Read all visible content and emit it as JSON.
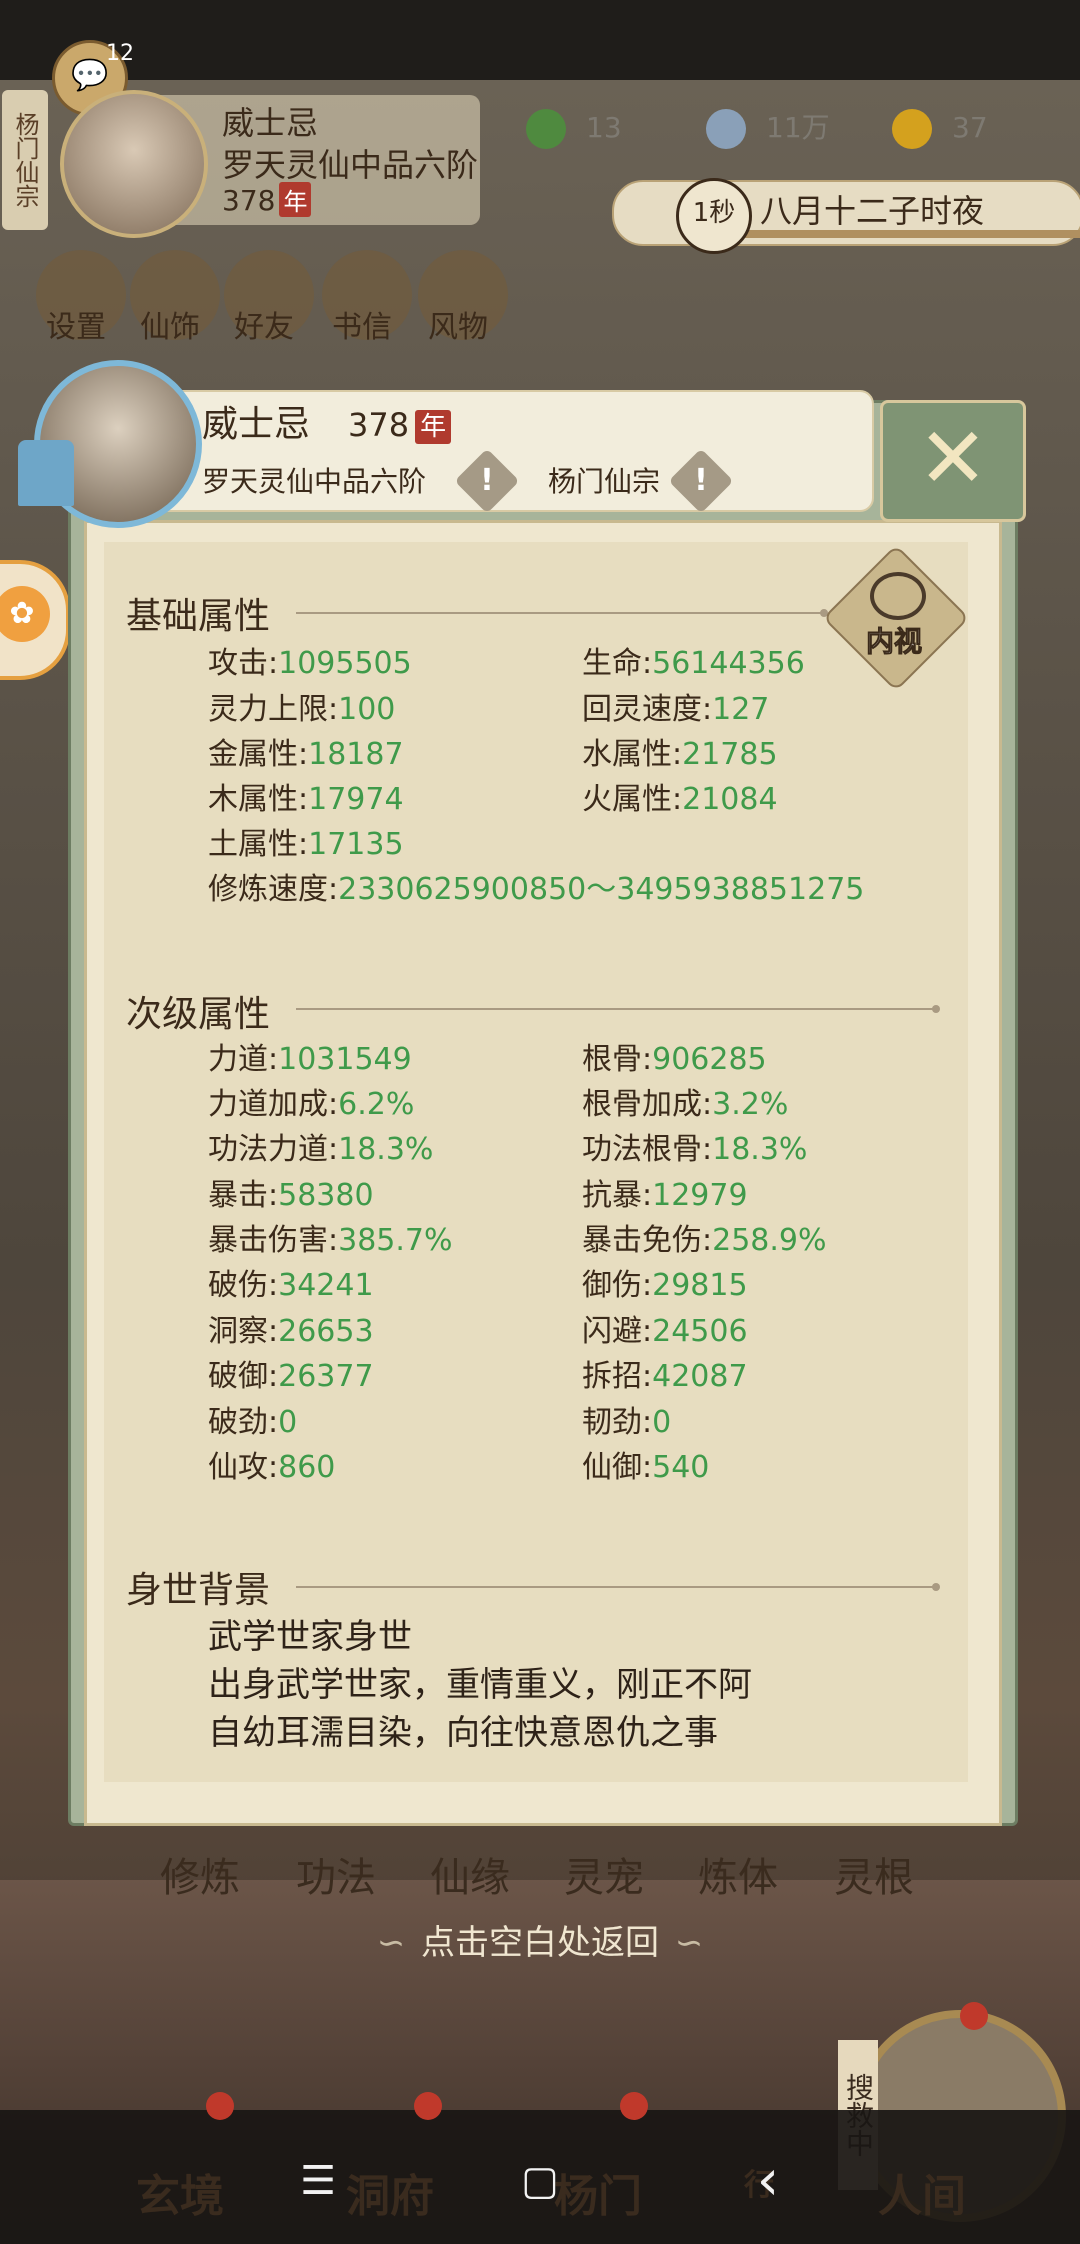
{
  "hud": {
    "side_tag": "杨门仙宗",
    "chat_count": "12",
    "name": "威士忌",
    "rank": "罗天灵仙中品六阶",
    "age": "378",
    "age_tag": "年",
    "resources": [
      {
        "icon": "leaf-icon",
        "value": "13"
      },
      {
        "icon": "coin-icon",
        "value": "11万"
      },
      {
        "icon": "trophy-icon",
        "value": "37"
      }
    ],
    "time_badge": "1秒",
    "time_text": "八月十二子时夜"
  },
  "menu": [
    {
      "label": "设置",
      "icon": "settings-icon"
    },
    {
      "label": "仙饰",
      "icon": "ornament-icon"
    },
    {
      "label": "好友",
      "icon": "friends-icon"
    },
    {
      "label": "书信",
      "icon": "letter-icon"
    },
    {
      "label": "风物",
      "icon": "scenery-icon"
    }
  ],
  "dialog": {
    "name": "威士忌",
    "age": "378",
    "age_tag": "年",
    "rank": "罗天灵仙中品六阶",
    "sect": "杨门仙宗",
    "close_label": "✕",
    "eye_label": "内视",
    "basic": {
      "title": "基础属性",
      "left": [
        {
          "k": "攻击",
          "v": "1095505"
        },
        {
          "k": "灵力上限",
          "v": "100"
        },
        {
          "k": "金属性",
          "v": "18187"
        },
        {
          "k": "木属性",
          "v": "17974"
        },
        {
          "k": "土属性",
          "v": "17135"
        },
        {
          "k": "修炼速度",
          "v": "2330625900850～3495938851275"
        }
      ],
      "right": [
        {
          "k": "生命",
          "v": "56144356"
        },
        {
          "k": "回灵速度",
          "v": "127"
        },
        {
          "k": "水属性",
          "v": "21785"
        },
        {
          "k": "火属性",
          "v": "21084"
        }
      ]
    },
    "secondary": {
      "title": "次级属性",
      "left": [
        {
          "k": "力道",
          "v": "1031549"
        },
        {
          "k": "力道加成",
          "v": "6.2%"
        },
        {
          "k": "功法力道",
          "v": "18.3%"
        },
        {
          "k": "暴击",
          "v": "58380"
        },
        {
          "k": "暴击伤害",
          "v": "385.7%"
        },
        {
          "k": "破伤",
          "v": "34241"
        },
        {
          "k": "洞察",
          "v": "26653"
        },
        {
          "k": "破御",
          "v": "26377"
        },
        {
          "k": "破劲",
          "v": "0"
        },
        {
          "k": "仙攻",
          "v": "860"
        }
      ],
      "right": [
        {
          "k": "根骨",
          "v": "906285"
        },
        {
          "k": "根骨加成",
          "v": "3.2%"
        },
        {
          "k": "功法根骨",
          "v": "18.3%"
        },
        {
          "k": "抗暴",
          "v": "12979"
        },
        {
          "k": "暴击免伤",
          "v": "258.9%"
        },
        {
          "k": "御伤",
          "v": "29815"
        },
        {
          "k": "闪避",
          "v": "24506"
        },
        {
          "k": "拆招",
          "v": "42087"
        },
        {
          "k": "韧劲",
          "v": "0"
        },
        {
          "k": "仙御",
          "v": "540"
        }
      ]
    },
    "background": {
      "title": "身世背景",
      "lines": [
        "武学世家身世",
        "出身武学世家，重情重义，刚正不阿",
        "自幼耳濡目染，向往快意恩仇之事"
      ]
    }
  },
  "tabs": [
    "修炼",
    "功法",
    "仙缘",
    "灵宠",
    "炼体",
    "灵根"
  ],
  "return_hint": "点击空白处返回",
  "bottom_nav": [
    "玄境",
    "洞府",
    "杨门",
    "行",
    "人间"
  ],
  "search_tag": "搜救中",
  "system_nav": {
    "menu": "☰",
    "home": "▢",
    "back": "‹"
  }
}
